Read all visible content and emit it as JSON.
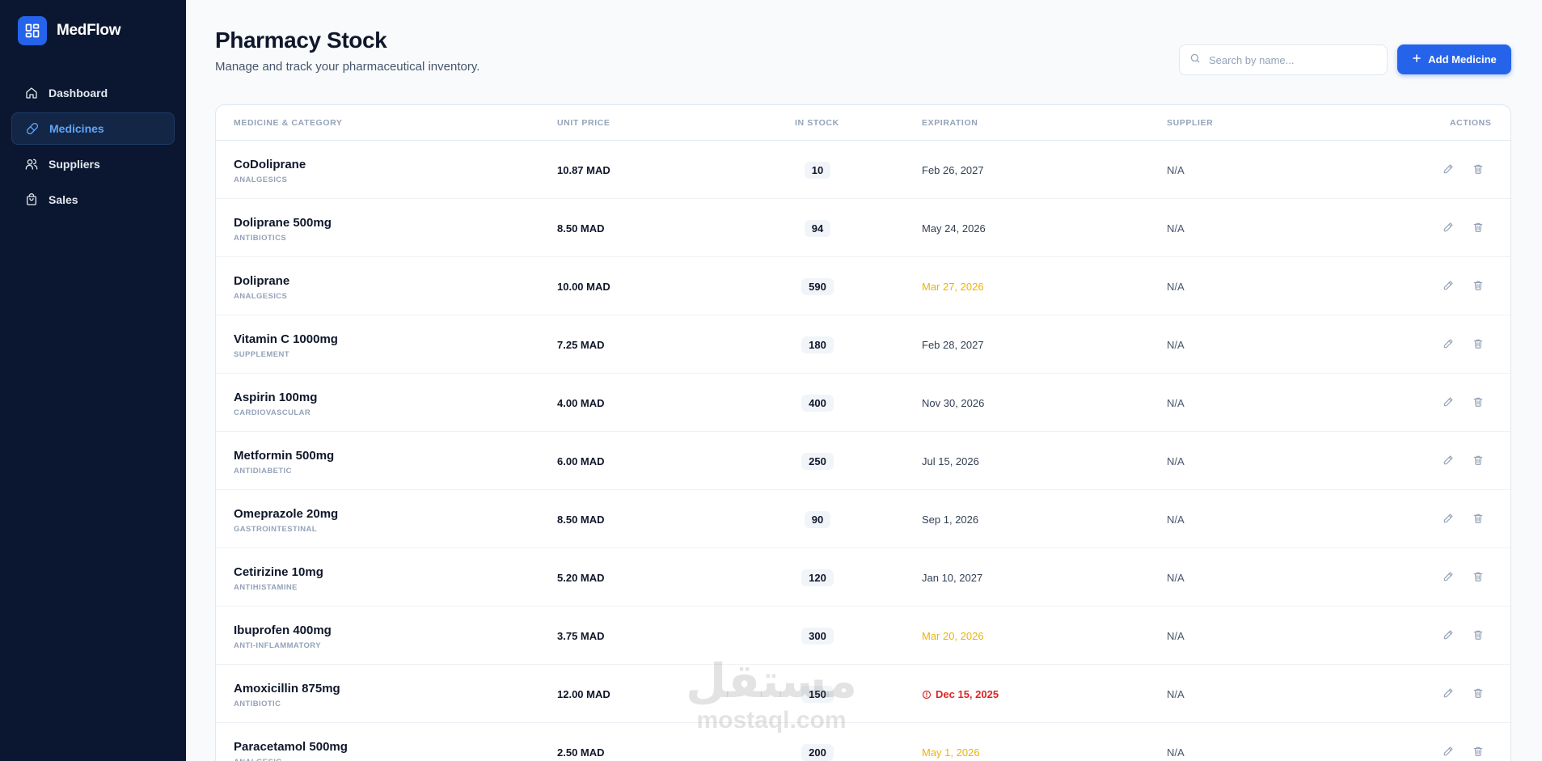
{
  "app": {
    "name": "MedFlow"
  },
  "sidebar": {
    "items": [
      {
        "label": "Dashboard",
        "icon": "home-icon",
        "active": false
      },
      {
        "label": "Medicines",
        "icon": "pill-icon",
        "active": true
      },
      {
        "label": "Suppliers",
        "icon": "users-icon",
        "active": false
      },
      {
        "label": "Sales",
        "icon": "shopping-bag-icon",
        "active": false
      }
    ]
  },
  "header": {
    "title": "Pharmacy Stock",
    "subtitle": "Manage and track your pharmaceutical inventory."
  },
  "search": {
    "placeholder": "Search by name...",
    "value": ""
  },
  "add_button": {
    "label": "Add Medicine"
  },
  "table": {
    "columns": {
      "medicine": "MEDICINE & CATEGORY",
      "price": "UNIT PRICE",
      "stock": "IN STOCK",
      "expiration": "EXPIRATION",
      "supplier": "SUPPLIER",
      "actions": "ACTIONS"
    },
    "rows": [
      {
        "name": "CoDoliprane",
        "category": "ANALGESICS",
        "price": "10.87 MAD",
        "stock": "10",
        "expiration": "Feb 26, 2027",
        "status": "normal",
        "supplier": "N/A"
      },
      {
        "name": "Doliprane 500mg",
        "category": "ANTIBIOTICS",
        "price": "8.50 MAD",
        "stock": "94",
        "expiration": "May 24, 2026",
        "status": "normal",
        "supplier": "N/A"
      },
      {
        "name": "Doliprane",
        "category": "ANALGESICS",
        "price": "10.00 MAD",
        "stock": "590",
        "expiration": "Mar 27, 2026",
        "status": "warning",
        "supplier": "N/A"
      },
      {
        "name": "Vitamin C 1000mg",
        "category": "SUPPLEMENT",
        "price": "7.25 MAD",
        "stock": "180",
        "expiration": "Feb 28, 2027",
        "status": "normal",
        "supplier": "N/A"
      },
      {
        "name": "Aspirin 100mg",
        "category": "CARDIOVASCULAR",
        "price": "4.00 MAD",
        "stock": "400",
        "expiration": "Nov 30, 2026",
        "status": "normal",
        "supplier": "N/A"
      },
      {
        "name": "Metformin 500mg",
        "category": "ANTIDIABETIC",
        "price": "6.00 MAD",
        "stock": "250",
        "expiration": "Jul 15, 2026",
        "status": "normal",
        "supplier": "N/A"
      },
      {
        "name": "Omeprazole 20mg",
        "category": "GASTROINTESTINAL",
        "price": "8.50 MAD",
        "stock": "90",
        "expiration": "Sep 1, 2026",
        "status": "normal",
        "supplier": "N/A"
      },
      {
        "name": "Cetirizine 10mg",
        "category": "ANTIHISTAMINE",
        "price": "5.20 MAD",
        "stock": "120",
        "expiration": "Jan 10, 2027",
        "status": "normal",
        "supplier": "N/A"
      },
      {
        "name": "Ibuprofen 400mg",
        "category": "ANTI-INFLAMMATORY",
        "price": "3.75 MAD",
        "stock": "300",
        "expiration": "Mar 20, 2026",
        "status": "warning",
        "supplier": "N/A"
      },
      {
        "name": "Amoxicillin 875mg",
        "category": "ANTIBIOTIC",
        "price": "12.00 MAD",
        "stock": "150",
        "expiration": "Dec 15, 2025",
        "status": "expired",
        "supplier": "N/A"
      },
      {
        "name": "Paracetamol 500mg",
        "category": "ANALGESIC",
        "price": "2.50 MAD",
        "stock": "200",
        "expiration": "May 1, 2026",
        "status": "warning",
        "supplier": "N/A"
      }
    ]
  },
  "watermark": {
    "arabic": "مستقل",
    "latin": "mostaql.com"
  },
  "colors": {
    "sidebar": "#0b1730",
    "accent": "#2563eb",
    "warning": "#eab308",
    "danger": "#dc2626"
  }
}
